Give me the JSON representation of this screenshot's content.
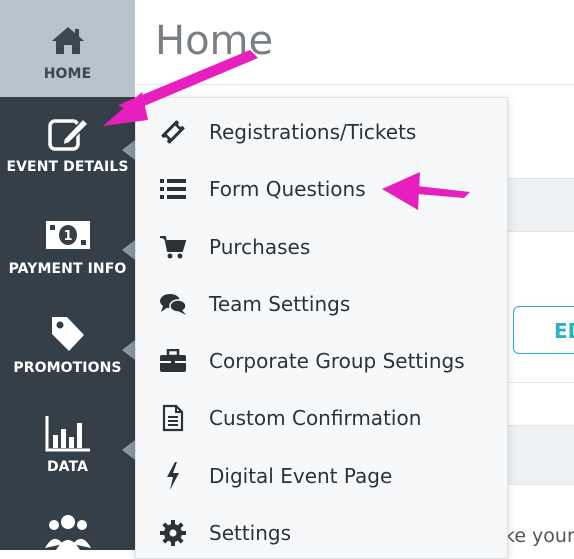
{
  "page": {
    "title": "Home"
  },
  "sidebar": {
    "items": [
      {
        "label": "HOME",
        "icon": "home-icon",
        "active": true
      },
      {
        "label": "EVENT DETAILS",
        "icon": "edit-icon"
      },
      {
        "label": "PAYMENT INFO",
        "icon": "money-icon"
      },
      {
        "label": "PROMOTIONS",
        "icon": "tag-icon"
      },
      {
        "label": "DATA",
        "icon": "bar-chart-icon"
      },
      {
        "label": "",
        "icon": "users-icon"
      }
    ]
  },
  "menu": {
    "items": [
      {
        "label": "Registrations/Tickets",
        "icon": "ticket-icon"
      },
      {
        "label": "Form Questions",
        "icon": "list-icon"
      },
      {
        "label": "Purchases",
        "icon": "cart-icon"
      },
      {
        "label": "Team Settings",
        "icon": "chat-bubbles-icon"
      },
      {
        "label": "Corporate Group Settings",
        "icon": "briefcase-icon"
      },
      {
        "label": "Custom Confirmation",
        "icon": "document-icon"
      },
      {
        "label": "Digital Event Page",
        "icon": "bolt-icon"
      },
      {
        "label": "Settings",
        "icon": "gear-icon"
      }
    ]
  },
  "background": {
    "edit_button_label": "ED",
    "partial_text": "ke your"
  },
  "colors": {
    "sidebar": "#343f47",
    "active": "#b8c4cc",
    "accent": "#2bb3c0",
    "annotation": "#e61fbe"
  }
}
